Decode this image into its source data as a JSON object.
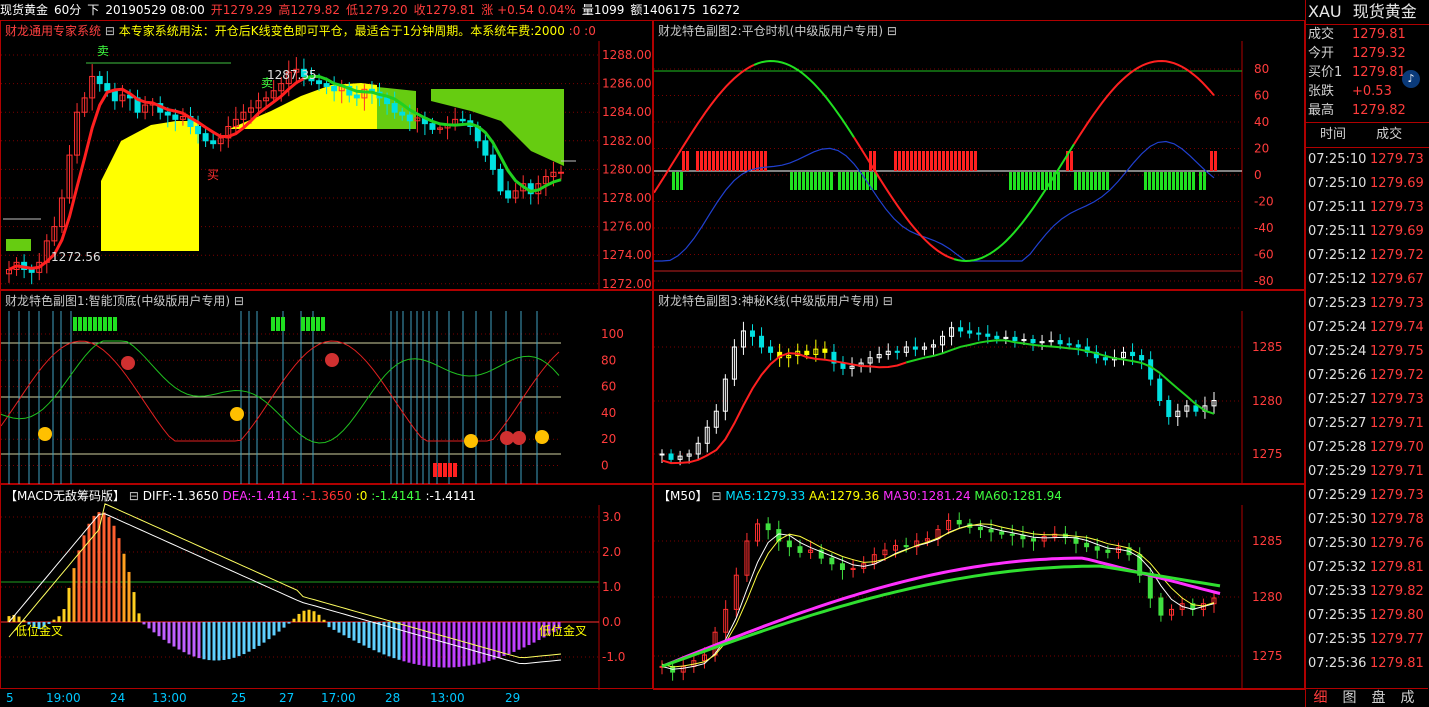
{
  "topbar": {
    "symbol": "现货黄金",
    "period": "60分",
    "label_down": "下",
    "datetime": "20190529 08:00",
    "open": "开1279.29",
    "high": "高1279.82",
    "low": "低1279.20",
    "close": "收1279.81",
    "change": "涨 +0.54 0.04%",
    "volume": "量1099",
    "amount": "额1406175",
    "extra": "16272"
  },
  "main_panel": {
    "title": "财龙通用专家系统",
    "title_icon": "minus-box-icon",
    "note": "本专家系统用法：开仓后K线变色即可平仓，最适合于1分钟周期。本系统年费:2000",
    "note_tail": ":0 :0",
    "sell_label_1": "卖",
    "sell_label_2": "卖",
    "buy_label": "买",
    "high_annot": "1287.35",
    "low_annot": "1272.56",
    "y_ticks": [
      "1288.00",
      "1286.00",
      "1284.00",
      "1282.00",
      "1280.00",
      "1278.00",
      "1276.00",
      "1274.00",
      "1272.00"
    ]
  },
  "panel_sub2": {
    "title": "财龙特色副图2:平仓时机(中级版用户专用)",
    "title_icon": "minus-box-icon",
    "y_ticks": [
      "80",
      "60",
      "40",
      "20",
      "0",
      "-20",
      "-40",
      "-60",
      "-80"
    ]
  },
  "panel_sub1": {
    "title": "财龙特色副图1:智能顶底(中级版用户专用)",
    "title_icon": "minus-box-icon",
    "y_ticks": [
      "100",
      "80",
      "60",
      "40",
      "20",
      "0"
    ]
  },
  "panel_sub3": {
    "title": "财龙特色副图3:神秘K线(中级版用户专用)",
    "title_icon": "minus-box-icon",
    "y_ticks": [
      "1285",
      "1280",
      "1275"
    ]
  },
  "panel_macd": {
    "title": "【MACD无敌筹码版】",
    "title_icon": "minus-box-icon",
    "diff": "DIFF:-1.3650",
    "dea": "DEA:-1.4141",
    "v1": ":-1.3650",
    "v2": ":0",
    "v3": ":-1.4141",
    "v4": ":-1.4141",
    "low_gold_1": "低位金叉",
    "low_gold_2": "低位金叉",
    "y_ticks": [
      "3.0",
      "2.0",
      "1.0",
      "0.0",
      "-1.0"
    ]
  },
  "panel_ma": {
    "title": "【M50】",
    "title_icon": "minus-box-icon",
    "ma5": "MA5:1279.33",
    "aa": "AA:1279.36",
    "ma30": "MA30:1281.24",
    "ma60": "MA60:1281.94",
    "y_ticks": [
      "1285",
      "1280",
      "1275"
    ]
  },
  "x_axis": [
    "5",
    "19:00",
    "24",
    "13:00",
    "25",
    "27",
    "17:00",
    "28",
    "13:00",
    "29"
  ],
  "quote": {
    "title_code": "XAU",
    "title_name": "现货黄金",
    "rows": [
      {
        "label": "成交",
        "value": "1279.81"
      },
      {
        "label": "今开",
        "value": "1279.32"
      },
      {
        "label": "买价1",
        "value": "1279.81"
      },
      {
        "label": "张跌",
        "value": "+0.53"
      },
      {
        "label": "最高",
        "value": "1279.82"
      }
    ],
    "col_time": "时间",
    "col_price": "成交",
    "ticks": [
      {
        "t": "07:25:10",
        "p": "1279.73"
      },
      {
        "t": "07:25:10",
        "p": "1279.69"
      },
      {
        "t": "07:25:11",
        "p": "1279.73"
      },
      {
        "t": "07:25:11",
        "p": "1279.69"
      },
      {
        "t": "07:25:12",
        "p": "1279.72"
      },
      {
        "t": "07:25:12",
        "p": "1279.67"
      },
      {
        "t": "07:25:23",
        "p": "1279.73"
      },
      {
        "t": "07:25:24",
        "p": "1279.74"
      },
      {
        "t": "07:25:24",
        "p": "1279.75"
      },
      {
        "t": "07:25:26",
        "p": "1279.72"
      },
      {
        "t": "07:25:27",
        "p": "1279.73"
      },
      {
        "t": "07:25:27",
        "p": "1279.71"
      },
      {
        "t": "07:25:28",
        "p": "1279.70"
      },
      {
        "t": "07:25:29",
        "p": "1279.71"
      },
      {
        "t": "07:25:29",
        "p": "1279.73"
      },
      {
        "t": "07:25:30",
        "p": "1279.78"
      },
      {
        "t": "07:25:30",
        "p": "1279.76"
      },
      {
        "t": "07:25:32",
        "p": "1279.81"
      },
      {
        "t": "07:25:33",
        "p": "1279.82"
      },
      {
        "t": "07:25:35",
        "p": "1279.80"
      },
      {
        "t": "07:25:35",
        "p": "1279.77"
      },
      {
        "t": "07:25:36",
        "p": "1279.81"
      }
    ],
    "tabs": [
      "细",
      "图",
      "盘",
      "成"
    ]
  },
  "colors": {
    "up": "#ff3030",
    "down": "#00e0e0",
    "yellow": "#ffff00",
    "green": "#40ff40",
    "frame": "#b00000",
    "magenta": "#ff30ff"
  }
}
